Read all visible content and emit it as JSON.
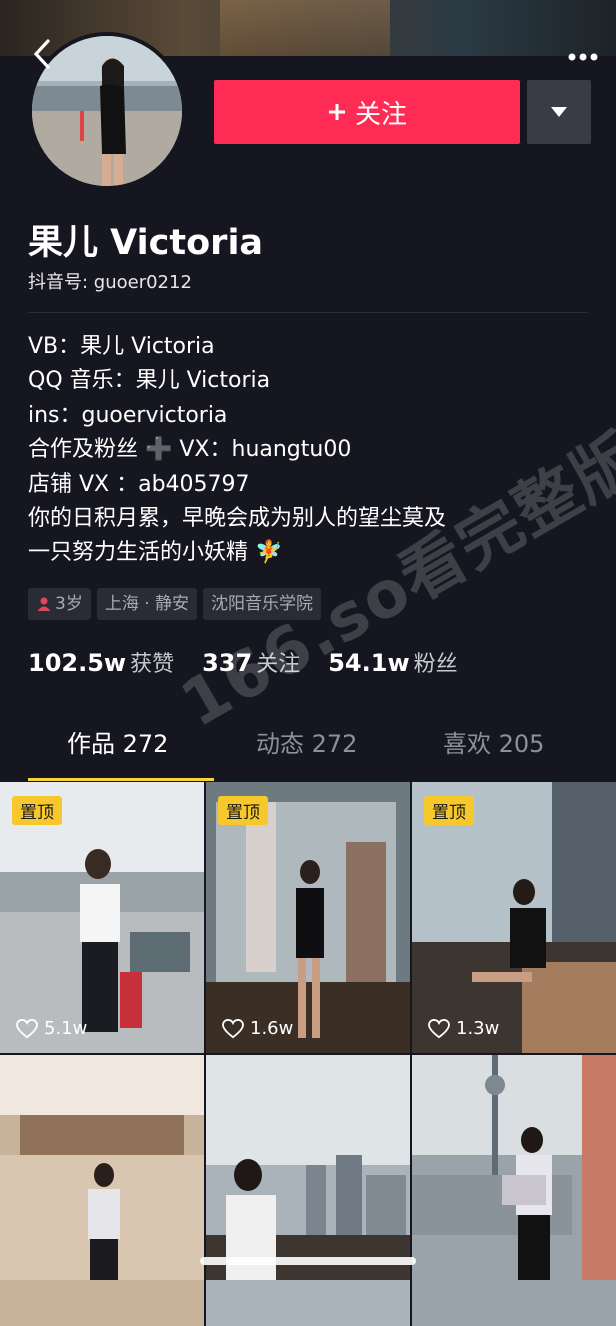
{
  "profile": {
    "name": "果儿 Victoria",
    "douyin_id": "抖音号: guoer0212",
    "follow_label": "关注"
  },
  "bio": [
    "VB：果儿 Victoria",
    "QQ 音乐：果儿 Victoria",
    "ins：guoervictoria",
    "合作及粉丝 ➕ VX：huangtu00",
    "店铺 VX ：ab405797",
    "你的日积月累，早晚会成为别人的望尘莫及",
    "一只努力生活的小妖精 🧚"
  ],
  "tags": [
    "3岁",
    "上海 · 静安",
    "沈阳音乐学院"
  ],
  "stats": [
    {
      "num": "102.5w",
      "label": "获赞"
    },
    {
      "num": "337",
      "label": "关注"
    },
    {
      "num": "54.1w",
      "label": "粉丝"
    }
  ],
  "tabs": [
    {
      "label": "作品 272"
    },
    {
      "label": "动态 272"
    },
    {
      "label": "喜欢 205"
    }
  ],
  "videos": [
    {
      "pinned": "置顶",
      "likes": "5.1w"
    },
    {
      "pinned": "置顶",
      "likes": "1.6w"
    },
    {
      "pinned": "置顶",
      "likes": "1.3w"
    },
    {
      "pinned": "",
      "likes": ""
    },
    {
      "pinned": "",
      "likes": ""
    },
    {
      "pinned": "",
      "likes": ""
    }
  ],
  "watermark": "166.so看完整版",
  "colors": {
    "accent": "#fe2c55",
    "background": "#15161f",
    "pin": "#f7c82c",
    "tab_underline": "#f8d33a"
  }
}
